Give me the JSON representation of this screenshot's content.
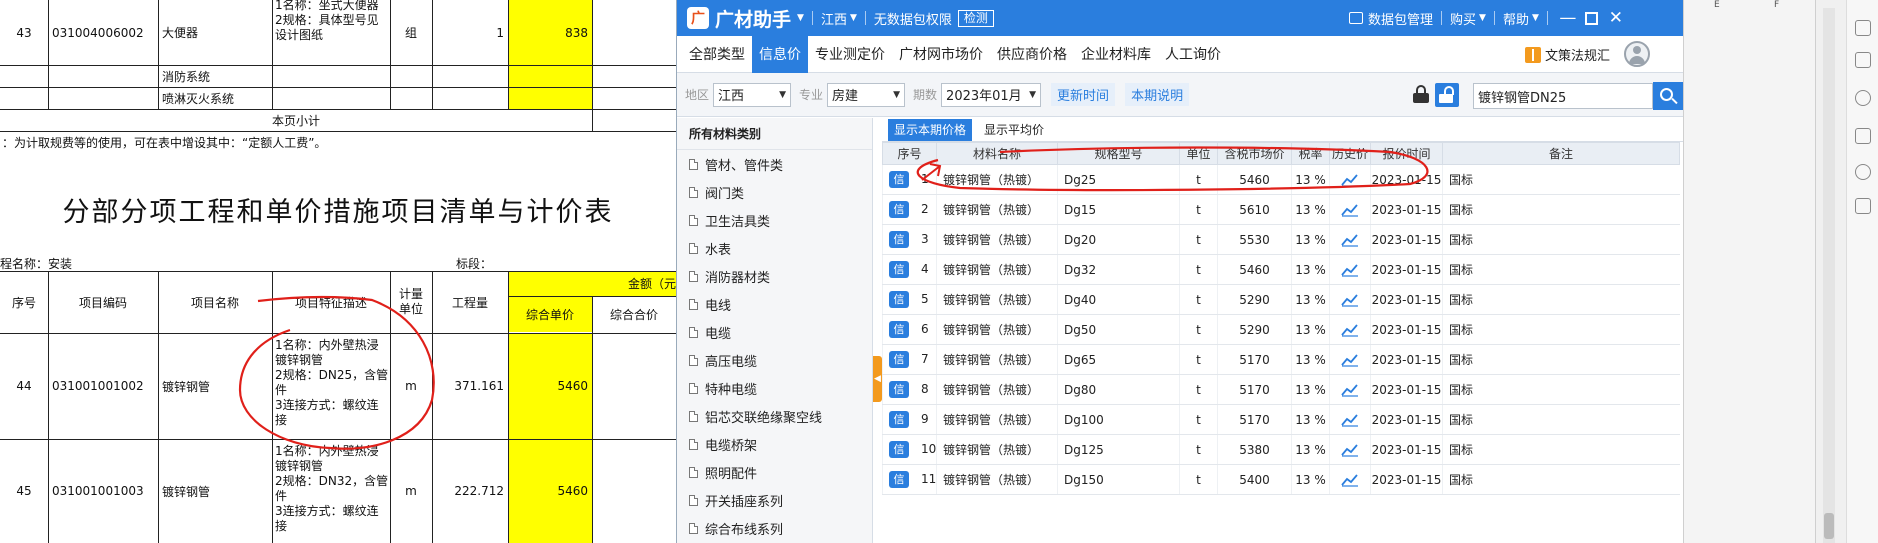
{
  "sheet": {
    "rows_top": {
      "r43": {
        "seq": "43",
        "code": "031004006002",
        "name": "大便器",
        "feature": "1名称：坐式大便器\n2规格：具体型号见\n设计图纸",
        "unit": "组",
        "qty": "1",
        "price": "838"
      },
      "fire_system": "消防系统",
      "sprinkler_system": "喷淋灭火系统",
      "page_subtotal": "本页小计"
    },
    "note": "：为计取规费等的使用，可在表中增设其中：“定额人工费”。",
    "title": "分部分项工程和单价措施项目清单与计价表",
    "project_name": "程名称：安装",
    "section_label": "标段：",
    "headers": {
      "seq": "序号",
      "code": "项目编码",
      "name": "项目名称",
      "feature": "项目特征描述",
      "unit": "计量\n单位",
      "qty": "工程量",
      "amount": "金额（元",
      "unit_price": "综合单价",
      "total": "综合合价"
    },
    "rows": [
      {
        "seq": "44",
        "code": "031001001002",
        "name": "镀锌钢管",
        "feature": "1名称：内外壁热浸\n镀锌钢管\n2规格：DN25，含管\n件\n3连接方式：螺纹连\n接",
        "unit": "m",
        "qty": "371.161",
        "price": "5460"
      },
      {
        "seq": "45",
        "code": "031001001003",
        "name": "镀锌钢管",
        "feature": "1名称：内外壁热浸\n镀锌钢管\n2规格：DN32，含管\n件\n3连接方式：螺纹连\n接",
        "unit": "m",
        "qty": "222.712",
        "price": "5460"
      }
    ]
  },
  "app": {
    "logo_badge": "广",
    "name": "广材助手",
    "region": "江西",
    "permission": "无数据包权限",
    "detect_button": "检测",
    "data_mgmt": "数据包管理",
    "buy": "购买",
    "help": "帮助",
    "nav_tabs": [
      "全部类型",
      "信息价",
      "专业测定价",
      "广材网市场价",
      "供应商价格",
      "企业材料库",
      "人工询价"
    ],
    "active_tab": 1,
    "law_link": "文策法规汇",
    "filters": {
      "region_label": "地区",
      "region_value": "江西",
      "major_label": "专业",
      "major_value": "房建",
      "period_label": "期数",
      "period_value": "2023年01月",
      "update_time": "更新时间",
      "period_note": "本期说明"
    },
    "search_value": "镀锌钢管DN25",
    "sidebar": {
      "header": "所有材料类别",
      "items": [
        "管材、管件类",
        "阀门类",
        "卫生洁具类",
        "水表",
        "消防器材类",
        "电线",
        "电缆",
        "高压电缆",
        "特种电缆",
        "铝芯交联绝缘聚空线",
        "电缆桥架",
        "照明配件",
        "开关插座系列",
        "综合布线系列"
      ]
    },
    "subtabs": [
      "显示本期价格",
      "显示平均价"
    ],
    "table": {
      "headers": [
        "序号",
        "材料名称",
        "规格型号",
        "单位",
        "含税市场价",
        "税率",
        "历史价",
        "报价时间",
        "备注"
      ],
      "badge": "信",
      "rows": [
        {
          "no": "1",
          "name": "镀锌钢管（热镀）",
          "spec": "Dg25",
          "unit": "t",
          "price": "5460",
          "tax": "13 %",
          "date": "2023-01-15",
          "remark": "国标"
        },
        {
          "no": "2",
          "name": "镀锌钢管（热镀）",
          "spec": "Dg15",
          "unit": "t",
          "price": "5610",
          "tax": "13 %",
          "date": "2023-01-15",
          "remark": "国标"
        },
        {
          "no": "3",
          "name": "镀锌钢管（热镀）",
          "spec": "Dg20",
          "unit": "t",
          "price": "5530",
          "tax": "13 %",
          "date": "2023-01-15",
          "remark": "国标"
        },
        {
          "no": "4",
          "name": "镀锌钢管（热镀）",
          "spec": "Dg32",
          "unit": "t",
          "price": "5460",
          "tax": "13 %",
          "date": "2023-01-15",
          "remark": "国标"
        },
        {
          "no": "5",
          "name": "镀锌钢管（热镀）",
          "spec": "Dg40",
          "unit": "t",
          "price": "5290",
          "tax": "13 %",
          "date": "2023-01-15",
          "remark": "国标"
        },
        {
          "no": "6",
          "name": "镀锌钢管（热镀）",
          "spec": "Dg50",
          "unit": "t",
          "price": "5290",
          "tax": "13 %",
          "date": "2023-01-15",
          "remark": "国标"
        },
        {
          "no": "7",
          "name": "镀锌钢管（热镀）",
          "spec": "Dg65",
          "unit": "t",
          "price": "5170",
          "tax": "13 %",
          "date": "2023-01-15",
          "remark": "国标"
        },
        {
          "no": "8",
          "name": "镀锌钢管（热镀）",
          "spec": "Dg80",
          "unit": "t",
          "price": "5170",
          "tax": "13 %",
          "date": "2023-01-15",
          "remark": "国标"
        },
        {
          "no": "9",
          "name": "镀锌钢管（热镀）",
          "spec": "Dg100",
          "unit": "t",
          "price": "5170",
          "tax": "13 %",
          "date": "2023-01-15",
          "remark": "国标"
        },
        {
          "no": "10",
          "name": "镀锌钢管（热镀）",
          "spec": "Dg125",
          "unit": "t",
          "price": "5380",
          "tax": "13 %",
          "date": "2023-01-15",
          "remark": "国标"
        },
        {
          "no": "11",
          "name": "镀锌钢管（热镀）",
          "spec": "Dg150",
          "unit": "t",
          "price": "5400",
          "tax": "13 %",
          "date": "2023-01-15",
          "remark": "国标"
        }
      ]
    }
  },
  "gutter": {
    "col_e": "E",
    "col_f": "F"
  },
  "colors": {
    "brand_blue": "#2a7ede",
    "highlight_yellow": "#ffff00",
    "annotation_red": "#e0201a",
    "accent_orange": "#f39a1e"
  },
  "icons": [
    "logo-icon",
    "caret-down-icon",
    "data-package-icon",
    "minimize-icon",
    "maximize-icon",
    "close-icon",
    "book-icon",
    "user-avatar-icon",
    "lock-icon",
    "unlock-icon",
    "search-icon",
    "document-icon",
    "trend-chart-icon"
  ]
}
